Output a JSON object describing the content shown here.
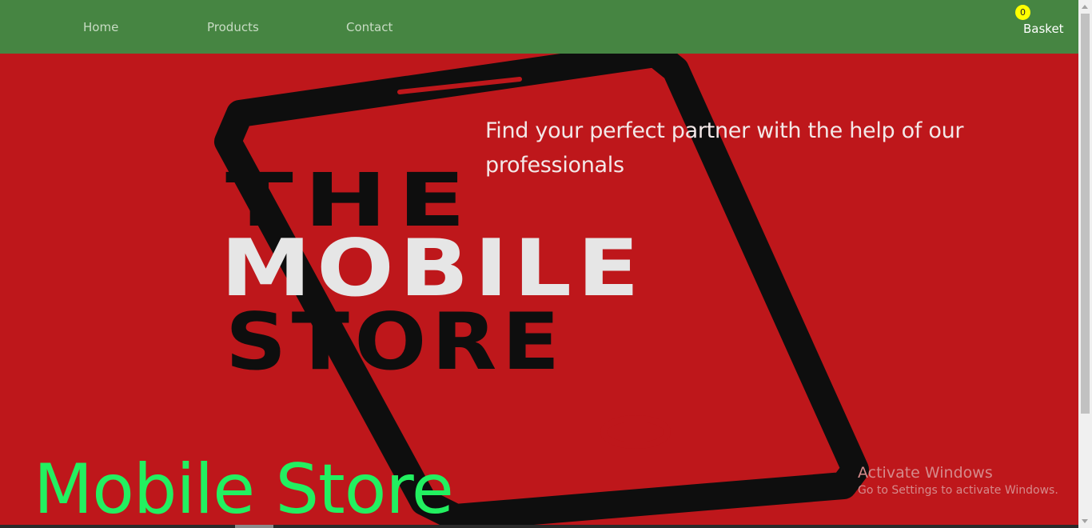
{
  "nav": {
    "home": "Home",
    "products": "Products",
    "contact": "Contact",
    "basket_label": "Basket",
    "basket_count": "0"
  },
  "hero": {
    "tagline": "Find your perfect partner with the help of our professionals",
    "logo_line1": "THE",
    "logo_line2": "MOBILE",
    "logo_line3": "STORE",
    "title": "Mobile Store"
  },
  "watermark": {
    "title": "Activate Windows",
    "subtitle": "Go to Settings to activate Windows."
  },
  "colors": {
    "navbar": "#468542",
    "hero_background": "#be171b",
    "title_green": "#22f060",
    "badge": "#ffff00"
  }
}
